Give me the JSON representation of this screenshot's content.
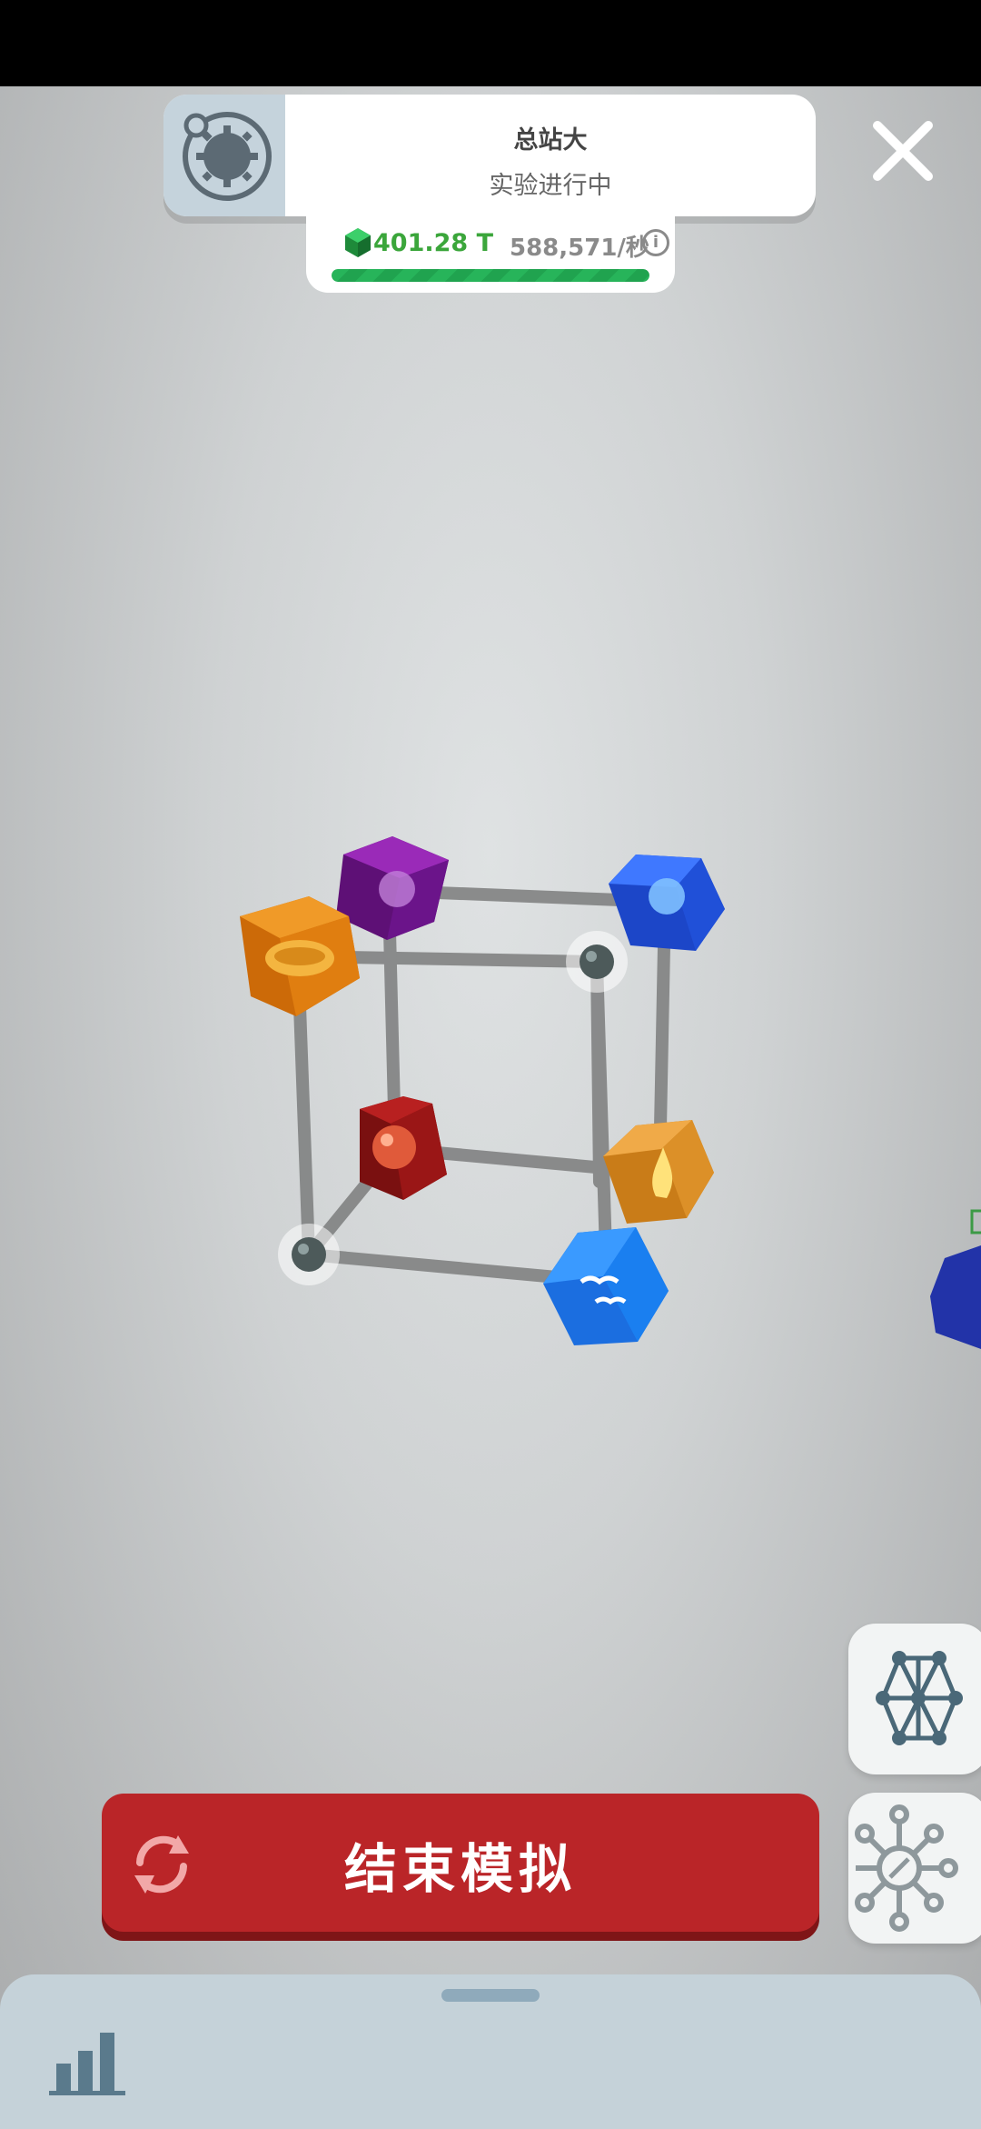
{
  "header": {
    "title": "总站大",
    "subtitle": "实验进行中",
    "icon": "gear-orbit-icon"
  },
  "close_icon": "close-icon",
  "stats": {
    "currency_icon": "green-gem-icon",
    "currency_value": "401.28 T",
    "rate_value": "588,571/秒",
    "info_label": "i",
    "progress": 1.0,
    "colors": {
      "currency": "#3ba63b",
      "progress": "#27b45a"
    }
  },
  "scene": {
    "nodes": [
      {
        "name": "purple-cube",
        "color": "#7a1a96"
      },
      {
        "name": "orange-cube-bread",
        "color": "#e8820f"
      },
      {
        "name": "blue-cube-top",
        "color": "#2a5ee8"
      },
      {
        "name": "red-cube",
        "color": "#a01a1a"
      },
      {
        "name": "orange-cube-flame",
        "color": "#e89a2a"
      },
      {
        "name": "blue-cube-birds",
        "color": "#1f80f0"
      },
      {
        "name": "glowing-sphere",
        "color": "#4d5a5a"
      }
    ]
  },
  "side_buttons": {
    "network_icon": "molecule-network-icon",
    "node_icon": "node-hub-icon"
  },
  "main_button": {
    "label": "结束模拟",
    "icon": "refresh-icon",
    "color": "#ba2528"
  },
  "bottom_sheet": {
    "stats_icon": "bar-chart-icon"
  }
}
